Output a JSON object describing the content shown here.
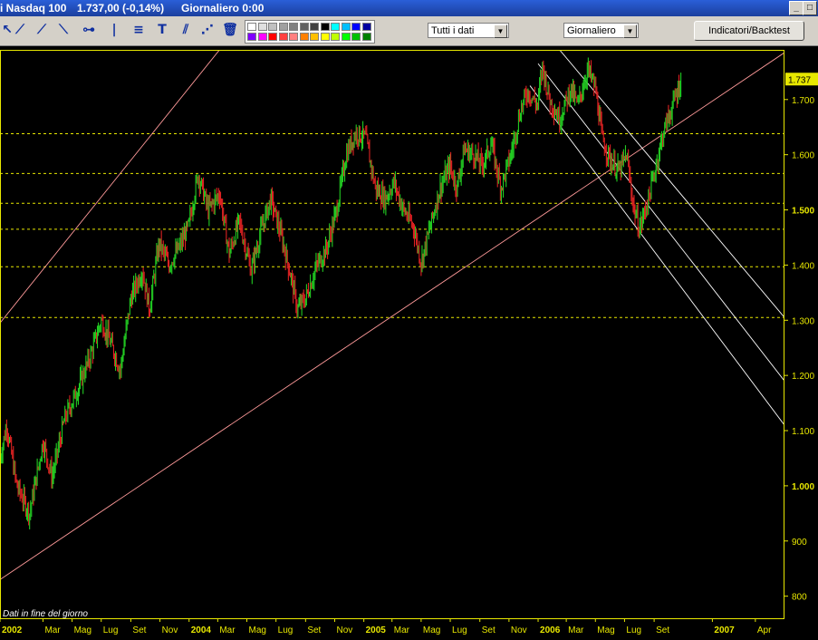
{
  "window": {
    "title": "i Nasdaq 100",
    "price": "1.737,00 (-0,14%)",
    "period_info": "Giornaliero  0:00"
  },
  "toolbar": {
    "range_select": "Tutti i dati",
    "period_select": "Giornaliero",
    "indicators_button": "Indicatori/Backtest",
    "icons": [
      "arrow-icon",
      "trendline-icon",
      "ray-icon",
      "extended-line-icon",
      "horizontal-line-icon",
      "vertical-line-icon",
      "fibonacci-icon",
      "text-icon",
      "parallel-channel-icon",
      "gann-fan-icon",
      "trash-icon",
      "tools-icon"
    ],
    "palette_colors": [
      "#ffffff",
      "#e0e0e0",
      "#c0c0c0",
      "#a0a0a0",
      "#808080",
      "#606060",
      "#404040",
      "#000000",
      "#00ffff",
      "#00c0ff",
      "#0000ff",
      "#0000a0",
      "#8000ff",
      "#ff00ff",
      "#ff0000",
      "#ff4040",
      "#ff8080",
      "#ff8000",
      "#ffc000",
      "#ffff00",
      "#c0ff00",
      "#00ff00",
      "#00c000",
      "#008000"
    ]
  },
  "status_text": "Dati in fine del giorno",
  "accent": {
    "up": "#22cc22",
    "down": "#dd2222",
    "support": "#e8e800",
    "channel_pink": "#ff9a9a",
    "channel_white": "#ffffff",
    "axis": "#e8e800"
  },
  "chart_data": {
    "type": "candlestick",
    "instrument": "Nasdaq 100",
    "period": "Giornaliero",
    "ylim": [
      760,
      1790
    ],
    "y_ticks": [
      {
        "value": 800,
        "label": "800"
      },
      {
        "value": 900,
        "label": "900"
      },
      {
        "value": 1000,
        "label": "1.000"
      },
      {
        "value": 1100,
        "label": "1.100"
      },
      {
        "value": 1200,
        "label": "1.200"
      },
      {
        "value": 1300,
        "label": "1.300"
      },
      {
        "value": 1400,
        "label": "1.400"
      },
      {
        "value": 1500,
        "label": "1.500"
      },
      {
        "value": 1600,
        "label": "1.600"
      },
      {
        "value": 1700,
        "label": "1.700"
      }
    ],
    "last_price_label": {
      "value": 1737,
      "label": "1.737"
    },
    "x_ticks": [
      "2002-12",
      "2003-03",
      "2003-05",
      "2003-07",
      "2003-09",
      "2003-11",
      "2004-01",
      "2004-03",
      "2004-05",
      "2004-07",
      "2004-09",
      "2004-11",
      "2005-01",
      "2005-03",
      "2005-05",
      "2005-07",
      "2005-09",
      "2005-11",
      "2006-01",
      "2006-03",
      "2006-05",
      "2006-07",
      "2006-09",
      "2007-01",
      "2007-04"
    ],
    "x_tick_labels": [
      "2002",
      "Mar",
      "Mag",
      "Lug",
      "Set",
      "Nov",
      "2004",
      "Mar",
      "Mag",
      "Lug",
      "Set",
      "Nov",
      "2005",
      "Mar",
      "Mag",
      "Lug",
      "Set",
      "Nov",
      "2006",
      "Mar",
      "Mag",
      "Lug",
      "Set",
      "2007",
      "Apr"
    ],
    "xlim": [
      "2002-12-01",
      "2007-06-01"
    ],
    "support_levels": [
      1638,
      1566,
      1512,
      1465,
      1397,
      1305
    ],
    "trendlines": [
      {
        "color": "pink",
        "from": [
          "2002-12-01",
          1295
        ],
        "to": [
          "2004-06-01",
          1885
        ]
      },
      {
        "color": "pink",
        "from": [
          "2002-12-01",
          830
        ],
        "to": [
          "2007-06-01",
          1785
        ]
      },
      {
        "color": "white",
        "from": [
          "2005-12-15",
          1725
        ],
        "to": [
          "2007-06-01",
          1110
        ]
      },
      {
        "color": "white",
        "from": [
          "2006-01-01",
          1765
        ],
        "to": [
          "2007-06-01",
          1190
        ]
      },
      {
        "color": "white",
        "from": [
          "2006-02-15",
          1790
        ],
        "to": [
          "2007-06-01",
          1305
        ]
      }
    ],
    "price_path": [
      [
        "2002-12-01",
        1050
      ],
      [
        "2002-12-15",
        1110
      ],
      [
        "2003-01-05",
        1000
      ],
      [
        "2003-02-01",
        950
      ],
      [
        "2003-03-01",
        1080
      ],
      [
        "2003-03-20",
        1015
      ],
      [
        "2003-04-15",
        1120
      ],
      [
        "2003-05-15",
        1180
      ],
      [
        "2003-06-10",
        1240
      ],
      [
        "2003-07-01",
        1300
      ],
      [
        "2003-07-20",
        1260
      ],
      [
        "2003-08-10",
        1210
      ],
      [
        "2003-09-01",
        1340
      ],
      [
        "2003-09-25",
        1390
      ],
      [
        "2003-10-10",
        1320
      ],
      [
        "2003-10-30",
        1440
      ],
      [
        "2003-11-20",
        1400
      ],
      [
        "2003-12-10",
        1430
      ],
      [
        "2003-12-31",
        1470
      ],
      [
        "2004-01-20",
        1565
      ],
      [
        "2004-02-10",
        1500
      ],
      [
        "2004-03-05",
        1530
      ],
      [
        "2004-03-25",
        1420
      ],
      [
        "2004-04-15",
        1480
      ],
      [
        "2004-05-10",
        1390
      ],
      [
        "2004-05-30",
        1460
      ],
      [
        "2004-06-20",
        1520
      ],
      [
        "2004-07-10",
        1460
      ],
      [
        "2004-08-01",
        1380
      ],
      [
        "2004-08-15",
        1320
      ],
      [
        "2004-09-01",
        1340
      ],
      [
        "2004-09-25",
        1400
      ],
      [
        "2004-10-15",
        1430
      ],
      [
        "2004-11-05",
        1500
      ],
      [
        "2004-11-25",
        1600
      ],
      [
        "2004-12-15",
        1640
      ],
      [
        "2005-01-05",
        1630
      ],
      [
        "2005-01-25",
        1540
      ],
      [
        "2005-02-15",
        1520
      ],
      [
        "2005-03-05",
        1550
      ],
      [
        "2005-03-25",
        1500
      ],
      [
        "2005-04-15",
        1470
      ],
      [
        "2005-05-01",
        1405
      ],
      [
        "2005-05-20",
        1470
      ],
      [
        "2005-06-10",
        1540
      ],
      [
        "2005-06-30",
        1580
      ],
      [
        "2005-07-15",
        1540
      ],
      [
        "2005-07-30",
        1610
      ],
      [
        "2005-08-20",
        1600
      ],
      [
        "2005-09-05",
        1580
      ],
      [
        "2005-09-25",
        1620
      ],
      [
        "2005-10-15",
        1540
      ],
      [
        "2005-11-05",
        1600
      ],
      [
        "2005-11-25",
        1680
      ],
      [
        "2005-12-10",
        1715
      ],
      [
        "2005-12-31",
        1690
      ],
      [
        "2006-01-10",
        1760
      ],
      [
        "2006-01-25",
        1700
      ],
      [
        "2006-02-15",
        1665
      ],
      [
        "2006-03-10",
        1720
      ],
      [
        "2006-03-25",
        1690
      ],
      [
        "2006-04-15",
        1755
      ],
      [
        "2006-05-01",
        1720
      ],
      [
        "2006-05-15",
        1630
      ],
      [
        "2006-06-01",
        1590
      ],
      [
        "2006-06-20",
        1570
      ],
      [
        "2006-07-05",
        1600
      ],
      [
        "2006-07-20",
        1505
      ],
      [
        "2006-08-01",
        1465
      ],
      [
        "2006-08-20",
        1520
      ],
      [
        "2006-09-05",
        1580
      ],
      [
        "2006-09-20",
        1640
      ],
      [
        "2006-10-10",
        1690
      ],
      [
        "2006-10-28",
        1737
      ]
    ]
  }
}
